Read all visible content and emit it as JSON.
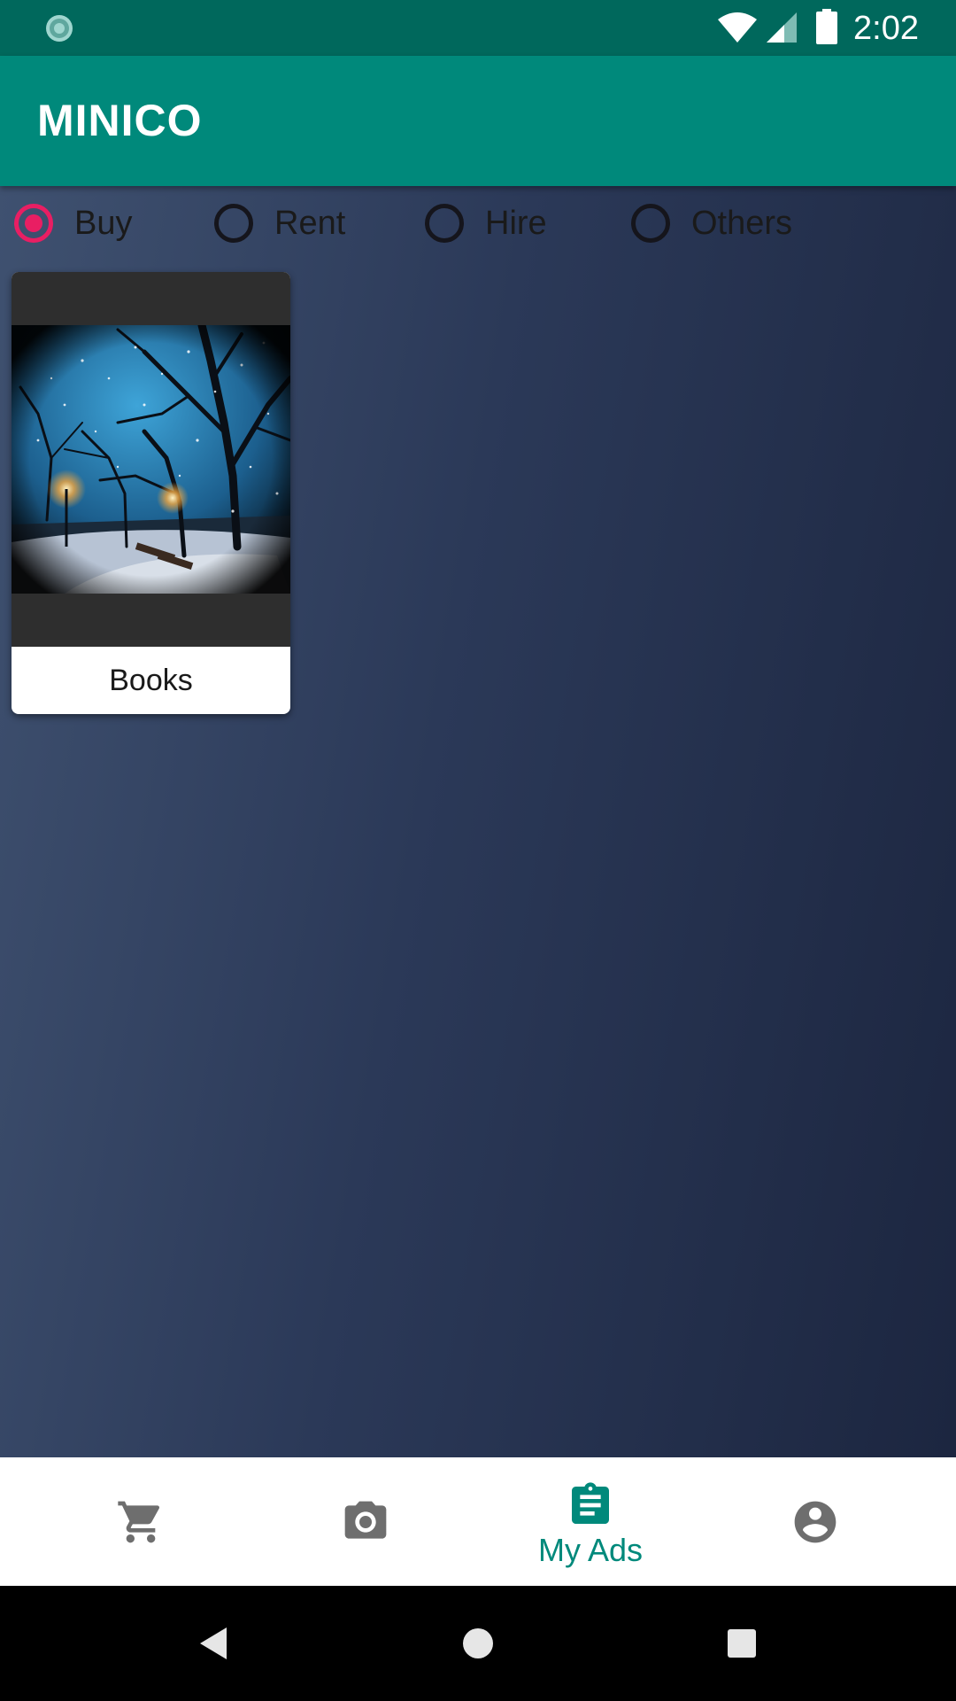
{
  "status_bar": {
    "time": "2:02",
    "icons": [
      "sync-icon",
      "wifi-icon",
      "cell-signal-icon",
      "battery-icon"
    ]
  },
  "app_bar": {
    "title": "MINICO"
  },
  "filters": {
    "selected": "Buy",
    "options": [
      {
        "label": "Buy",
        "checked": true
      },
      {
        "label": "Rent",
        "checked": false
      },
      {
        "label": "Hire",
        "checked": false
      },
      {
        "label": "Others",
        "checked": false
      }
    ]
  },
  "ads": [
    {
      "title": "Books",
      "image": "snowy-park-night-photo"
    }
  ],
  "bottom_nav": {
    "active": "My Ads",
    "items": [
      {
        "icon": "cart-icon",
        "label": ""
      },
      {
        "icon": "camera-icon",
        "label": ""
      },
      {
        "icon": "clipboard-icon",
        "label": "My Ads"
      },
      {
        "icon": "account-circle-icon",
        "label": ""
      }
    ]
  },
  "system_nav": {
    "icons": [
      "back-icon",
      "home-icon",
      "recents-icon"
    ]
  },
  "colors": {
    "status_bar": "#00685c",
    "app_bar": "#00897b",
    "accent": "#e91e63",
    "nav_active": "#00897b",
    "nav_inactive": "#6e6e6e"
  }
}
